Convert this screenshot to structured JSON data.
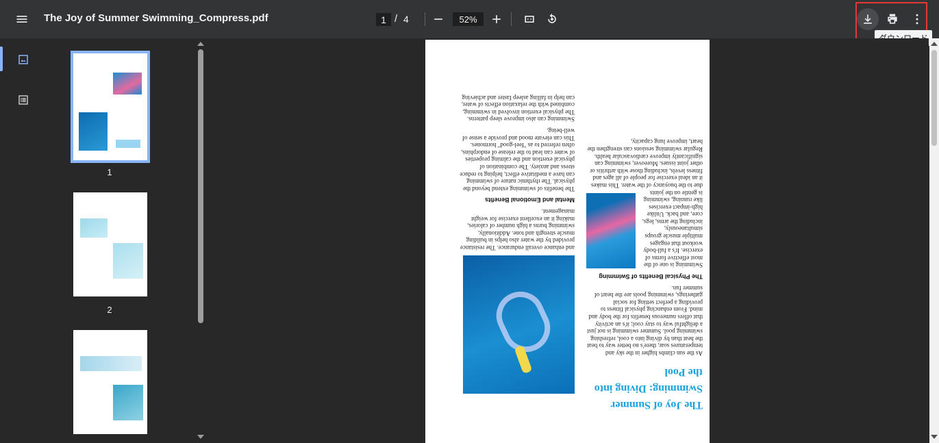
{
  "toolbar": {
    "title": "The Joy of Summer Swimming_Compress.pdf",
    "current_page": "1",
    "page_separator": "/",
    "total_pages": "4",
    "zoom": "52%",
    "download_tooltip": "ダウンロード"
  },
  "thumbnails": [
    {
      "label": "1"
    },
    {
      "label": "2"
    }
  ],
  "document": {
    "title": "The Joy of Summer Swimming: Diving into the Pool",
    "intro": "As the sun climbs higher in the sky and temperatures soar, there's no better way to beat the heat than by diving into a cool, refreshing swimming pool. Summer swimming is not just a delightful way to stay cool; it's an activity that offers numerous benefits for the body and mind. From enhancing physical fitness to providing a perfect setting for social gatherings, swimming pools are the heart of summer fun.",
    "physical_heading": "The Physical Benefits of Swimming",
    "physical_p1": "Swimming is one of the most effective forms of exercise. It's a full-body workout that engages multiple muscle groups simultaneously, including the arms, legs, core, and back. Unlike high-impact exercises like running, swimming is gentle on the joints due to the buoyancy of the water. This makes it an ideal exercise for people of all ages and fitness levels, including those with arthritis or other joint issues. Moreover, swimming can significantly improve cardiovascular health. Regular swimming sessions can strengthen the heart, improve lung capacity,",
    "col2_p1": "and enhance overall endurance. The resistance provided by the water also helps in building muscle strength and tone. Additionally, swimming burns a high number of calories, making it an excellent exercise for weight management.",
    "mental_heading": "Mental and Emotional Benefits",
    "mental_p1": "The benefits of swimming extend beyond the physical. The rhythmic nature of swimming can have a meditative effect, helping to reduce stress and anxiety. The combination of physical exertion and the calming properties of water can lead to the release of endorphins, often referred to as \"feel-good\" hormones. This can elevate mood and provide a sense of well-being.",
    "mental_p2": "Swimming can also improve sleep patterns. The physical exertion involved in swimming, combined with the relaxation effects of water, can help in falling asleep faster and achieving"
  },
  "colors": {
    "toolbar_bg": "#333436",
    "viewer_bg": "#282828",
    "accent": "#8ab4f8",
    "title_blue": "#1aa3e0",
    "highlight": "#e53935"
  }
}
